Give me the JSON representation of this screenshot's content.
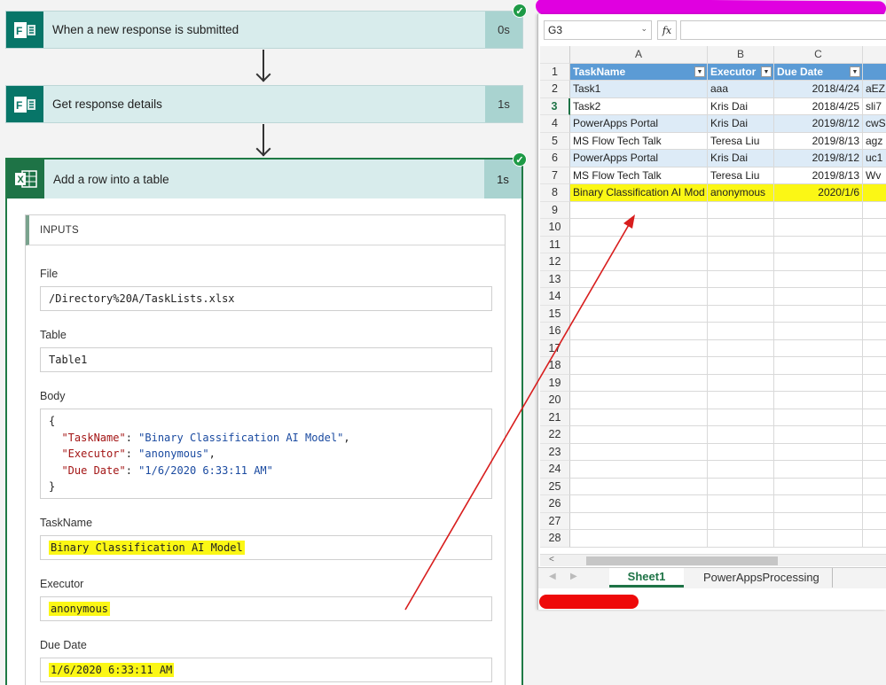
{
  "flow": {
    "trigger": {
      "title": "When a new response is submitted",
      "duration": "0s"
    },
    "get_details": {
      "title": "Get response details",
      "duration": "1s"
    },
    "add_row": {
      "title": "Add a row into a table",
      "duration": "1s",
      "inputs_heading": "INPUTS",
      "file_label": "File",
      "file_value": "/Directory%20A/TaskLists.xlsx",
      "table_label": "Table",
      "table_value": "Table1",
      "body_label": "Body",
      "body": {
        "open": "{",
        "k1": "\"TaskName\"",
        "v1": "\"Binary Classification AI Model\"",
        "k2": "\"Executor\"",
        "v2": "\"anonymous\"",
        "k3": "\"Due Date\"",
        "v3": "\"1/6/2020 6:33:11 AM\"",
        "close": "}"
      },
      "taskname_label": "TaskName",
      "taskname_value": "Binary Classification AI Model",
      "executor_label": "Executor",
      "executor_value": "anonymous",
      "duedate_label": "Due Date",
      "duedate_value": "1/6/2020 6:33:11 AM"
    }
  },
  "excel": {
    "name_box": "G3",
    "fx": "fx",
    "columns": [
      "A",
      "B",
      "C",
      ""
    ],
    "headers": [
      "TaskName",
      "Executor",
      "Due Date",
      ""
    ],
    "rows": [
      [
        "Task1",
        "aaa",
        "2018/4/24",
        "aEZ"
      ],
      [
        "Task2",
        "Kris Dai",
        "2018/4/25",
        "sli7"
      ],
      [
        "PowerApps Portal",
        "Kris Dai",
        "2019/8/12",
        "cwS"
      ],
      [
        "MS Flow Tech Talk",
        "Teresa Liu",
        "2019/8/13",
        "agz"
      ],
      [
        "PowerApps Portal",
        "Kris Dai",
        "2019/8/12",
        "uc1"
      ],
      [
        "MS Flow Tech Talk",
        "Teresa Liu",
        "2019/8/13",
        "Wv"
      ],
      [
        "Binary Classification AI Mod",
        "anonymous",
        "2020/1/6",
        ""
      ]
    ],
    "row_numbers": [
      "1",
      "2",
      "3",
      "4",
      "5",
      "6",
      "7",
      "8",
      "9",
      "10",
      "11",
      "12",
      "13",
      "14",
      "15",
      "16",
      "17",
      "18",
      "19",
      "20",
      "21",
      "22",
      "23",
      "24",
      "25",
      "26",
      "27",
      "28"
    ],
    "selected_row": "3",
    "sheet_tabs": [
      "Sheet1",
      "PowerAppsProcessing"
    ],
    "accent": "#1e7346",
    "header_fill": "#5b9bd5",
    "highlight": "#fbf715"
  }
}
